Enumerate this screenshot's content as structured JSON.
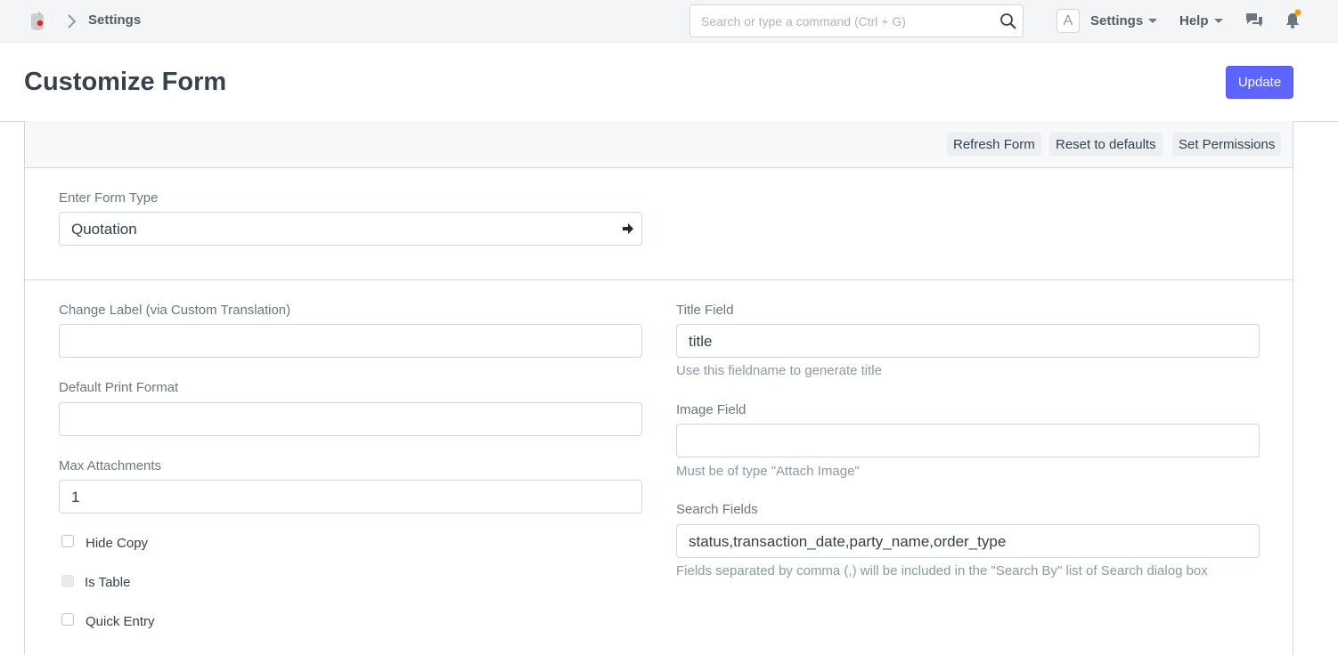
{
  "navbar": {
    "breadcrumb": "Settings",
    "search": {
      "placeholder": "Search or type a command (Ctrl + G)",
      "value": ""
    },
    "avatar_letter": "A",
    "menus": {
      "settings": "Settings",
      "help": "Help"
    },
    "icons": {
      "logo": "app-logo-icon",
      "chevron": "chevron-right-icon",
      "search": "search-icon",
      "chat": "chat-icon",
      "bell": "bell-icon"
    },
    "notification_dot_color": "#ff9800"
  },
  "page": {
    "title": "Customize Form",
    "primary_action": "Update",
    "accent_color": "#5e64ff"
  },
  "toolbar": {
    "buttons": [
      "Refresh Form",
      "Reset to defaults",
      "Set Permissions"
    ]
  },
  "form_type": {
    "label": "Enter Form Type",
    "value": "Quotation",
    "icon": "arrow-right-icon"
  },
  "left_fields": {
    "change_label": {
      "label": "Change Label (via Custom Translation)",
      "value": ""
    },
    "default_print_format": {
      "label": "Default Print Format",
      "value": ""
    },
    "max_attachments": {
      "label": "Max Attachments",
      "value": "1"
    }
  },
  "checkboxes": [
    {
      "label": "Hide Copy",
      "checked": false,
      "disabled": false
    },
    {
      "label": "Is Table",
      "checked": false,
      "disabled": true
    },
    {
      "label": "Quick Entry",
      "checked": false,
      "disabled": false
    }
  ],
  "right_fields": {
    "title_field": {
      "label": "Title Field",
      "value": "title",
      "help": "Use this fieldname to generate title"
    },
    "image_field": {
      "label": "Image Field",
      "value": "",
      "help": "Must be of type \"Attach Image\""
    },
    "search_fields": {
      "label": "Search Fields",
      "value": "status,transaction_date,party_name,order_type",
      "help": "Fields separated by comma (,) will be included in the \"Search By\" list of Search dialog box"
    }
  }
}
